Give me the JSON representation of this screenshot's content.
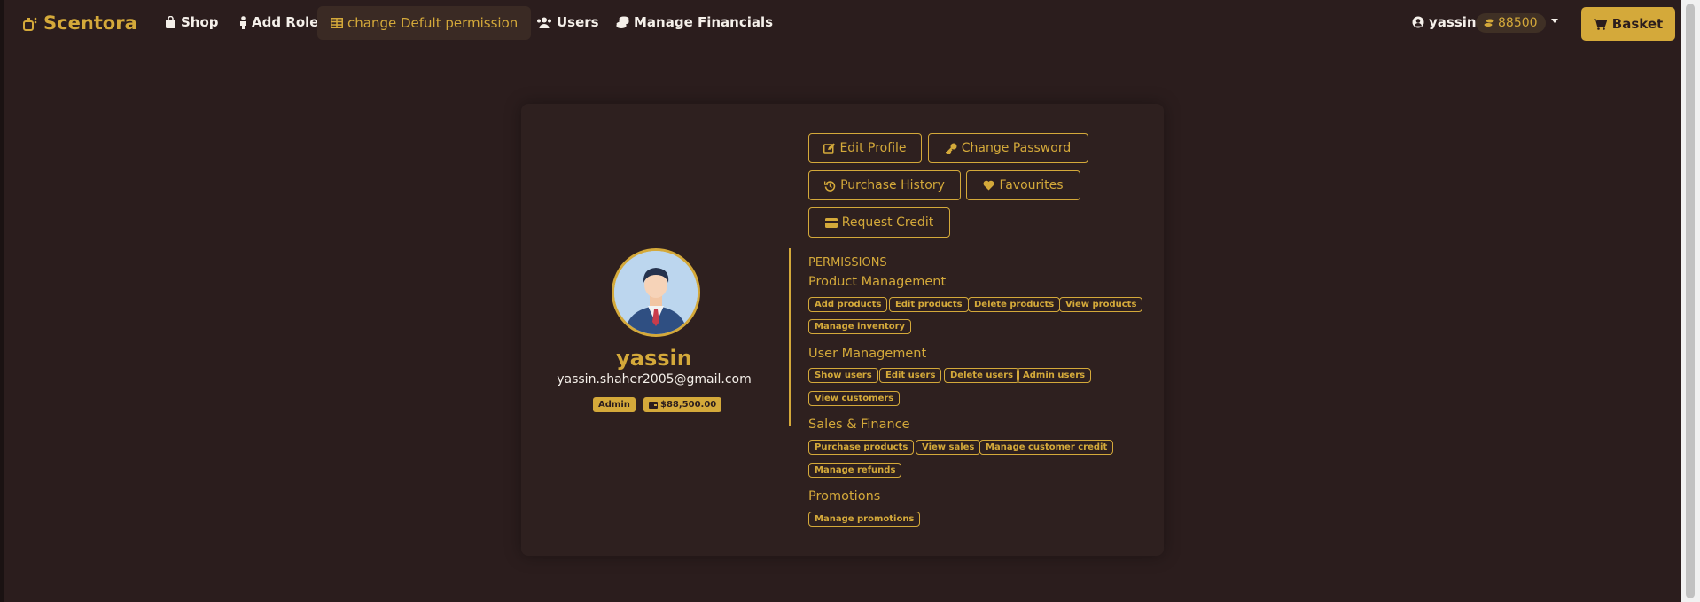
{
  "nav": {
    "brand": "Scentora",
    "shop": "Shop",
    "add_role": "Add Role",
    "change_permission": "change Defult permission",
    "users": "Users",
    "manage_financials": "Manage Financials",
    "user": "yassin",
    "credits": "88500",
    "basket": "Basket"
  },
  "profile": {
    "username": "yassin",
    "email": "yassin.shaher2005@gmail.com",
    "role_badge": "Admin",
    "balance_badge": "$88,500.00"
  },
  "actions": {
    "edit_profile": "Edit Profile",
    "change_password": "Change Password",
    "purchase_history": "Purchase History",
    "favourites": "Favourites",
    "request_credit": "Request Credit"
  },
  "permissions": {
    "title": "PERMISSIONS",
    "groups": [
      {
        "name": "Product Management",
        "items": [
          "Add products",
          "Edit products",
          "Delete products",
          "View products",
          "Manage inventory"
        ]
      },
      {
        "name": "User Management",
        "items": [
          "Show users",
          "Edit users",
          "Delete users",
          "Admin users",
          "View customers"
        ]
      },
      {
        "name": "Sales & Finance",
        "items": [
          "Purchase products",
          "View sales",
          "Manage customer credit",
          "Manage refunds"
        ]
      },
      {
        "name": "Promotions",
        "items": [
          "Manage promotions"
        ]
      }
    ]
  },
  "colors": {
    "background": "#2b1d1d",
    "accent": "#d4a93a",
    "text_light": "#f5f0ea"
  }
}
